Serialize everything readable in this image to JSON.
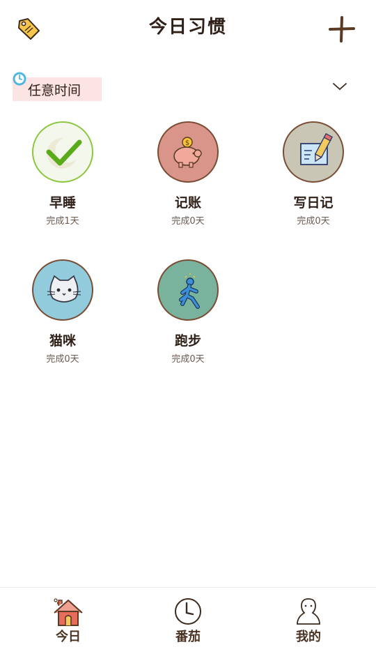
{
  "header": {
    "title": "今日习惯",
    "left_icon": "tag-icon",
    "right_icon": "plus-icon"
  },
  "filter": {
    "label": "任意时间",
    "icon": "clock-icon",
    "dropdown_icon": "chevron-down-icon"
  },
  "habits": [
    {
      "name": "早睡",
      "progress": "完成1天",
      "icon": "checkmark-icon",
      "bg": "#f4f7ec",
      "border": "#8cc63f"
    },
    {
      "name": "记账",
      "progress": "完成0天",
      "icon": "piggy-bank-icon",
      "bg": "#d9958a"
    },
    {
      "name": "写日记",
      "progress": "完成0天",
      "icon": "notebook-pencil-icon",
      "bg": "#c9c6b6"
    },
    {
      "name": "猫咪",
      "progress": "完成0天",
      "icon": "cat-icon",
      "bg": "#92cbdc"
    },
    {
      "name": "跑步",
      "progress": "完成0天",
      "icon": "runner-icon",
      "bg": "#79b39d"
    }
  ],
  "tabbar": {
    "tabs": [
      {
        "label": "今日",
        "icon": "house-icon",
        "active": true
      },
      {
        "label": "番茄",
        "icon": "clock-icon"
      },
      {
        "label": "我的",
        "icon": "person-icon"
      }
    ]
  }
}
